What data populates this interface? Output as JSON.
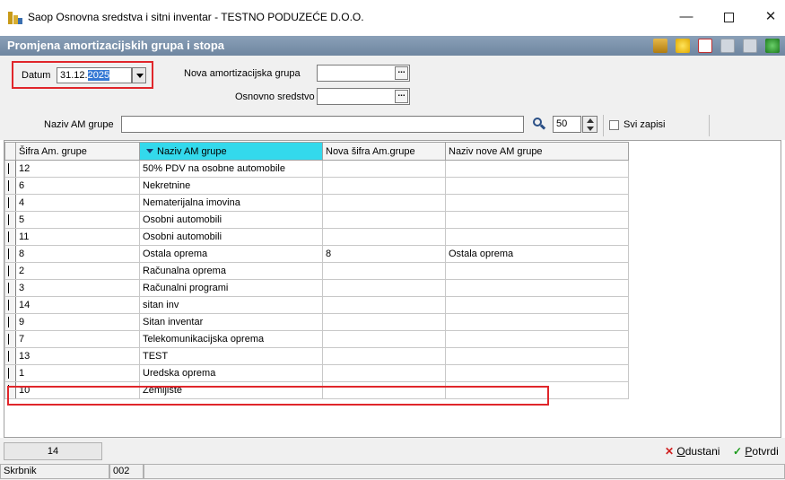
{
  "window": {
    "title": "Saop Osnovna sredstva i sitni inventar - TESTNO PODUZEĆE D.O.O.",
    "min": "—",
    "max": "",
    "close": "✕"
  },
  "form": {
    "title": "Promjena amortizacijskih grupa i stopa"
  },
  "filters": {
    "datum_label": "Datum",
    "datum_value_plain": "31.12.",
    "datum_value_selected": "2025",
    "nova_grupa_label": "Nova amortizacijska grupa",
    "osnovno_sredstvo_label": "Osnovno sredstvo",
    "dots": "...",
    "naziv_label": "Naziv AM grupe",
    "naziv_value": "",
    "page_size": "50",
    "svi_zapisi_label": "Svi zapisi"
  },
  "grid": {
    "columns": [
      "Šifra Am. grupe",
      "Naziv AM grupe",
      "Nova šifra Am.grupe",
      "Naziv nove AM grupe"
    ],
    "rows": [
      [
        "12",
        "50% PDV na osobne automobile",
        "",
        ""
      ],
      [
        "6",
        "Nekretnine",
        "",
        ""
      ],
      [
        "4",
        "Nematerijalna imovina",
        "",
        ""
      ],
      [
        "5",
        "Osobni automobili",
        "",
        ""
      ],
      [
        "11",
        "Osobni automobili",
        "",
        ""
      ],
      [
        "8",
        "Ostala oprema",
        "8",
        "Ostala oprema"
      ],
      [
        "2",
        "Računalna oprema",
        "",
        ""
      ],
      [
        "3",
        "Računalni programi",
        "",
        ""
      ],
      [
        "14",
        "sitan inv",
        "",
        ""
      ],
      [
        "9",
        "Sitan inventar",
        "",
        ""
      ],
      [
        "7",
        "Telekomunikacijska oprema",
        "",
        ""
      ],
      [
        "13",
        "TEST",
        "",
        ""
      ],
      [
        "1",
        "Uredska oprema",
        "",
        ""
      ],
      [
        "10",
        "Zemljište",
        "",
        ""
      ]
    ]
  },
  "footer": {
    "count": "14",
    "odustani_prefix": "",
    "odustani_u": "O",
    "odustani_rest": "dustani",
    "potvrdi_u": "P",
    "potvrdi_rest": "otvrdi",
    "status_user": "Skrbnik",
    "status_code": "002"
  },
  "colors": {
    "header_bar": "#7a90aa",
    "sorted_column": "#33d9ec",
    "highlight": "#e0262b",
    "selection": "#3478d4"
  }
}
